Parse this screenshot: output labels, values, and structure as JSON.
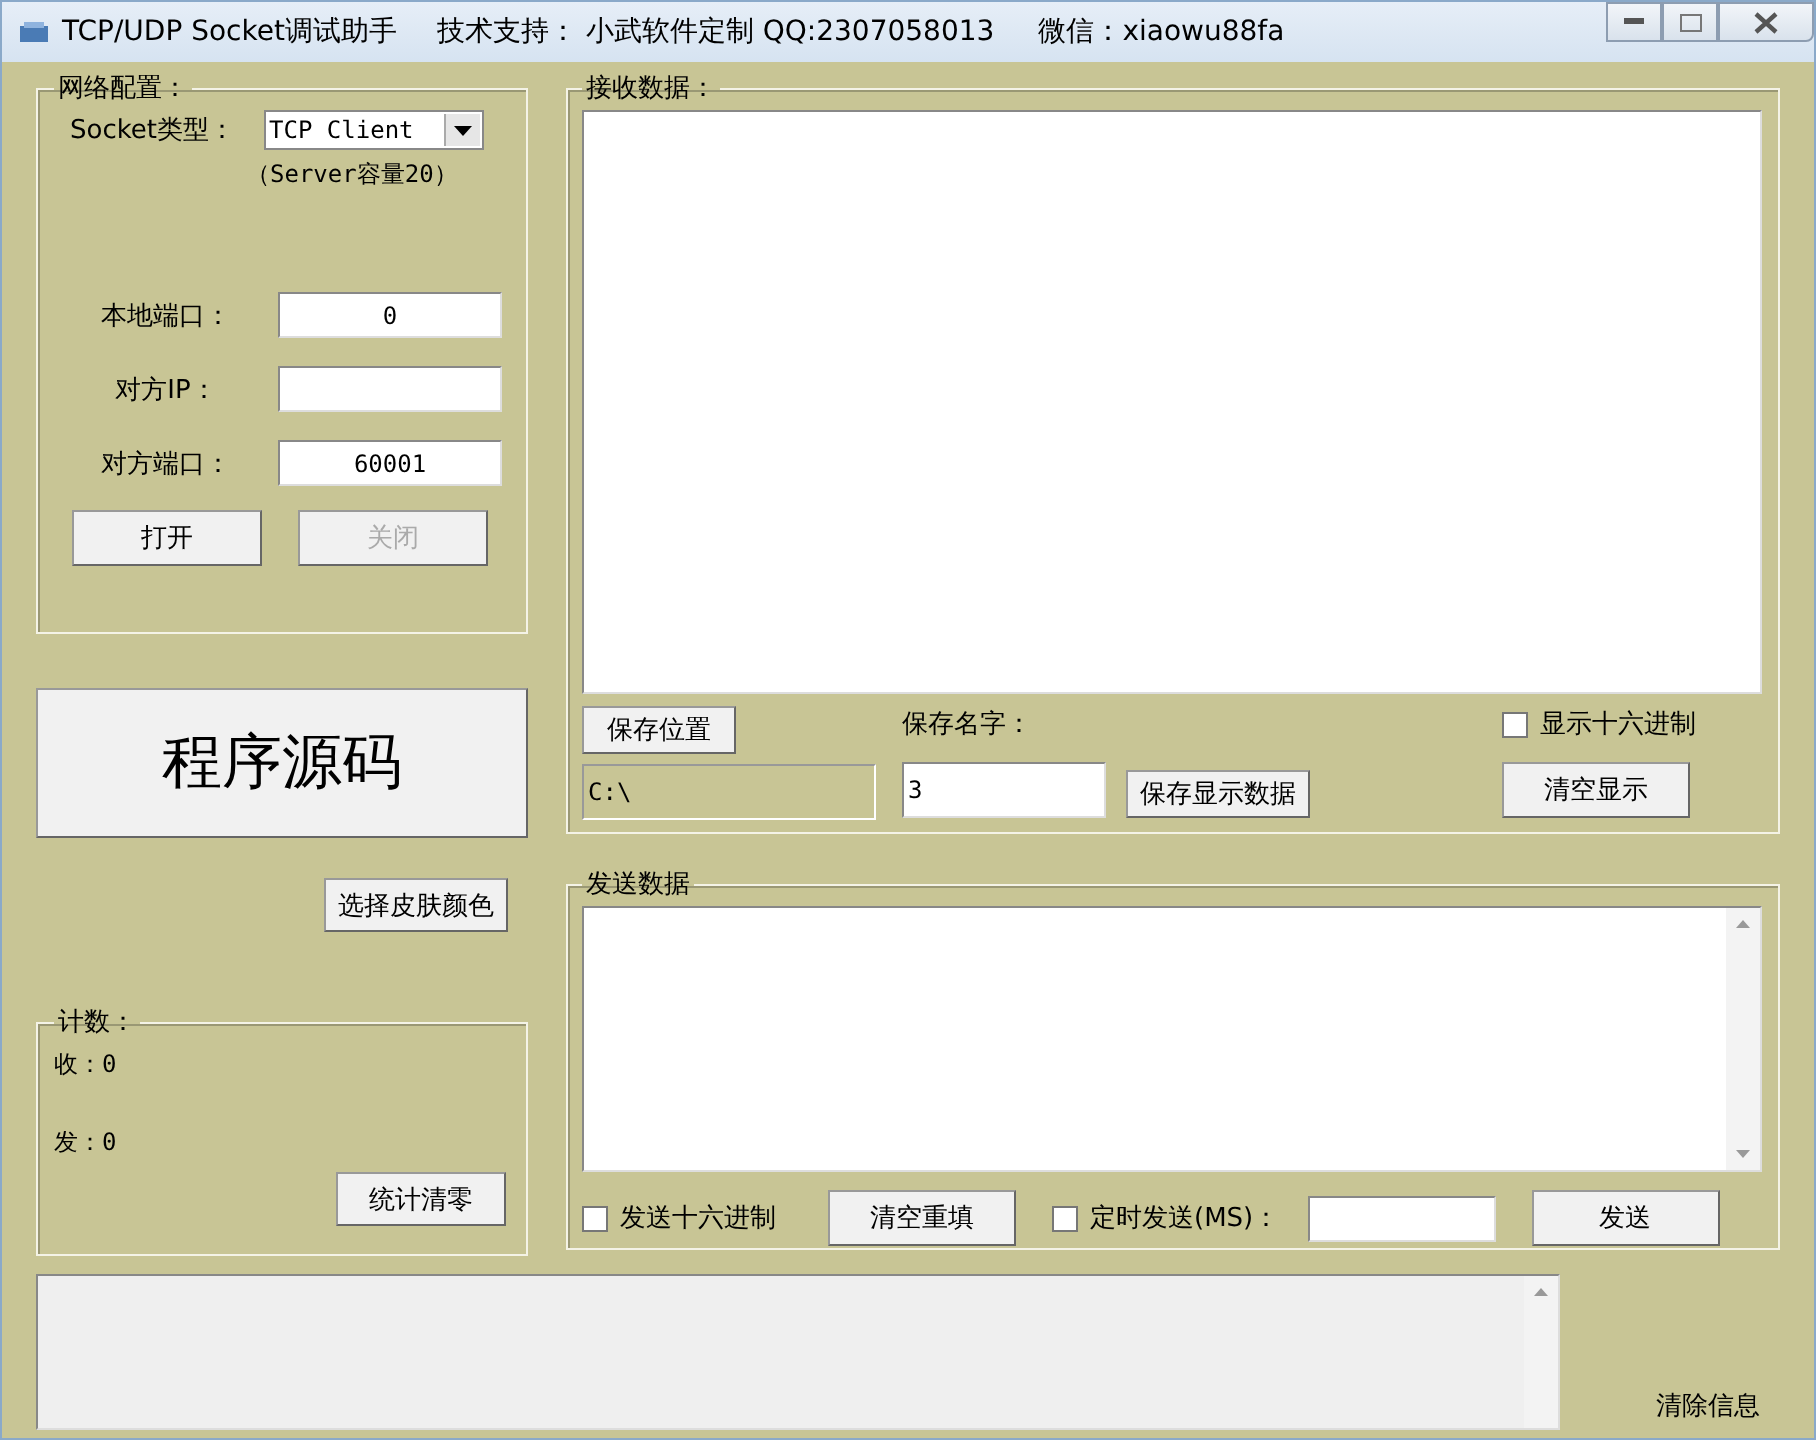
{
  "window": {
    "title": "TCP/UDP Socket调试助手",
    "support": "技术支持： 小武软件定制 QQ:2307058013",
    "wechat": "微信：xiaowu88fa"
  },
  "network": {
    "legend": "网络配置：",
    "socket_type_label": "Socket类型：",
    "socket_type": "TCP Client",
    "capacity_note": "（Server容量20）",
    "fields": [
      {
        "label": "本地端口：",
        "value": "0"
      },
      {
        "label": "对方IP："
      },
      {
        "label": "对方端口：",
        "value": "60001"
      }
    ],
    "buttons": [
      {
        "label": "打开",
        "disabled": false
      },
      {
        "label": "关闭",
        "disabled": true
      }
    ]
  },
  "source_button": "程序源码",
  "skin_button": "选择皮肤颜色",
  "counts": {
    "legend": "计数：",
    "lines": [
      "收：0",
      "发：0"
    ],
    "reset_button": "统计清零"
  },
  "receive": {
    "legend": "接收数据：",
    "save_location_button": "保存位置",
    "save_path": "C:\\",
    "save_name_label": "保存名字：",
    "save_name": "3",
    "save_display_button": "保存显示数据",
    "hex_display": {
      "label": "显示十六进制",
      "checked": false
    },
    "clear_button": "清空显示"
  },
  "send": {
    "legend": "发送数据",
    "hex_send": {
      "label": "发送十六进制",
      "checked": false
    },
    "clear_button": "清空重填",
    "timed_send": {
      "label": "定时发送(MS)：",
      "checked": false
    },
    "send_button": "发送"
  },
  "info": {
    "clear_button": "清除信息"
  }
}
